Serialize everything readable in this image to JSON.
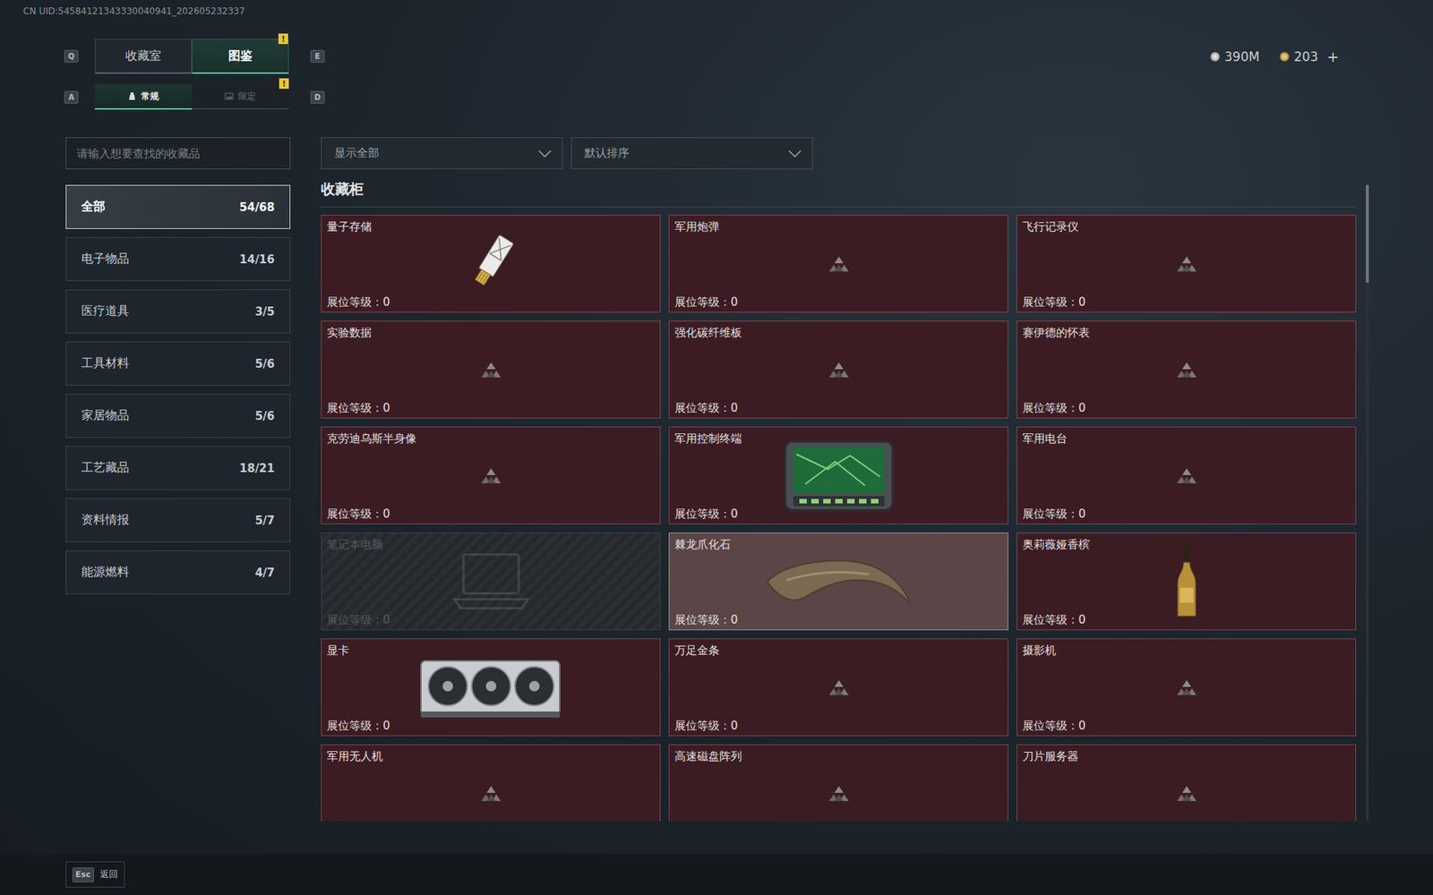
{
  "uid": "CN UID:54584121343330040941_202605232337",
  "main_tabs": {
    "prev_key": "Q",
    "next_key": "E",
    "items": [
      {
        "label": "收藏室",
        "selected": false
      },
      {
        "label": "图鉴",
        "selected": true,
        "badge": "!"
      }
    ]
  },
  "sub_tabs": {
    "prev_key": "A",
    "next_key": "D",
    "items": [
      {
        "label": "常规",
        "selected": true
      },
      {
        "label": "限定",
        "selected": false,
        "badge": "!"
      }
    ]
  },
  "currency": [
    {
      "amount": "390M",
      "kind": "silver"
    },
    {
      "amount": "203",
      "kind": "gold",
      "add": "+"
    }
  ],
  "search": {
    "placeholder": "请输入想要查找的收藏品"
  },
  "filters": [
    {
      "value": "显示全部"
    },
    {
      "value": "默认排序"
    }
  ],
  "sidebar": {
    "items": [
      {
        "label": "全部",
        "count": "54/68",
        "selected": true
      },
      {
        "label": "电子物品",
        "count": "14/16",
        "selected": false
      },
      {
        "label": "医疗道具",
        "count": "3/5",
        "selected": false
      },
      {
        "label": "工具材料",
        "count": "5/6",
        "selected": false
      },
      {
        "label": "家居物品",
        "count": "5/6",
        "selected": false
      },
      {
        "label": "工艺藏品",
        "count": "18/21",
        "selected": false
      },
      {
        "label": "资料情报",
        "count": "5/7",
        "selected": false
      },
      {
        "label": "能源燃料",
        "count": "4/7",
        "selected": false
      }
    ]
  },
  "section": {
    "title": "收藏柜"
  },
  "cards": [
    {
      "name": "量子存储",
      "level_label": "展位等级：",
      "level": "0",
      "kind": "thumbnail",
      "selected": false,
      "disabled": false
    },
    {
      "name": "军用炮弹",
      "level_label": "展位等级：",
      "level": "0",
      "kind": "placeholder",
      "selected": false,
      "disabled": false
    },
    {
      "name": "飞行记录仪",
      "level_label": "展位等级：",
      "level": "0",
      "kind": "placeholder",
      "selected": false,
      "disabled": false
    },
    {
      "name": "实验数据",
      "level_label": "展位等级：",
      "level": "0",
      "kind": "placeholder",
      "selected": false,
      "disabled": false
    },
    {
      "name": "强化碳纤维板",
      "level_label": "展位等级：",
      "level": "0",
      "kind": "placeholder",
      "selected": false,
      "disabled": false
    },
    {
      "name": "赛伊德的怀表",
      "level_label": "展位等级：",
      "level": "0",
      "kind": "placeholder",
      "selected": false,
      "disabled": false
    },
    {
      "name": "克劳迪乌斯半身像",
      "level_label": "展位等级：",
      "level": "0",
      "kind": "placeholder",
      "selected": false,
      "disabled": false
    },
    {
      "name": "军用控制终端",
      "level_label": "展位等级：",
      "level": "0",
      "kind": "thumbnail",
      "selected": false,
      "disabled": false
    },
    {
      "name": "军用电台",
      "level_label": "展位等级：",
      "level": "0",
      "kind": "placeholder",
      "selected": false,
      "disabled": false
    },
    {
      "name": "笔记本电脑",
      "level_label": "展位等级：",
      "level": "0",
      "kind": "thumbnail",
      "selected": false,
      "disabled": true
    },
    {
      "name": "棘龙爪化石",
      "level_label": "展位等级：",
      "level": "0",
      "kind": "thumbnail",
      "selected": true,
      "disabled": false
    },
    {
      "name": "奥莉薇娅香槟",
      "level_label": "展位等级：",
      "level": "0",
      "kind": "thumbnail",
      "selected": false,
      "disabled": false
    },
    {
      "name": "显卡",
      "level_label": "展位等级：",
      "level": "0",
      "kind": "thumbnail",
      "selected": false,
      "disabled": false
    },
    {
      "name": "万足金条",
      "level_label": "展位等级：",
      "level": "0",
      "kind": "placeholder",
      "selected": false,
      "disabled": false
    },
    {
      "name": "摄影机",
      "level_label": "展位等级：",
      "level": "0",
      "kind": "placeholder",
      "selected": false,
      "disabled": false
    },
    {
      "name": "军用无人机",
      "kind": "placeholder",
      "selected": false,
      "disabled": false
    },
    {
      "name": "高速磁盘阵列",
      "kind": "placeholder",
      "selected": false,
      "disabled": false
    },
    {
      "name": "刀片服务器",
      "kind": "placeholder",
      "selected": false,
      "disabled": false
    }
  ],
  "footer": {
    "key": "Esc",
    "label": "返回"
  }
}
